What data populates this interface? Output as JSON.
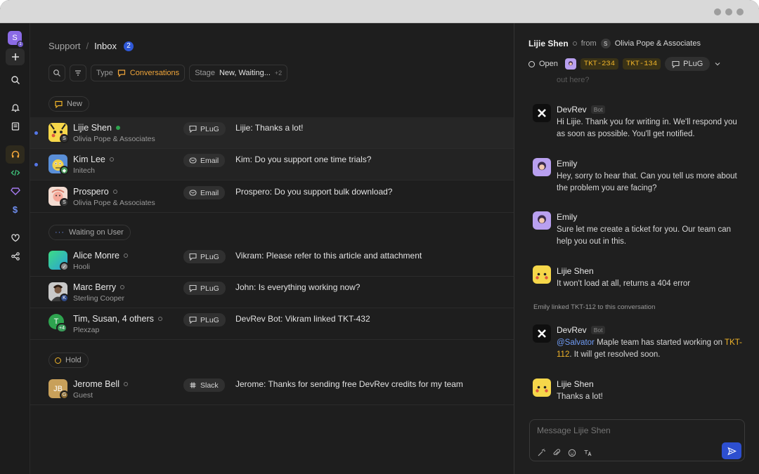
{
  "sidebar": {
    "workspace_initial": "S",
    "workspace_badge": "1",
    "icons": [
      "plus-icon",
      "search-icon",
      "bell-icon",
      "notes-icon",
      "headset-icon",
      "code-icon",
      "diamond-icon",
      "dollar-icon",
      "heart-icon",
      "share-icon"
    ]
  },
  "header": {
    "crumb_root": "Support",
    "crumb_sep": "/",
    "crumb_current": "Inbox",
    "inbox_count": "2"
  },
  "filters": {
    "type_label": "Type",
    "type_value": "Conversations",
    "stage_label": "Stage",
    "stage_value": "New, Waiting...",
    "stage_extra": "+2"
  },
  "groups": {
    "new": "New",
    "waiting": "Waiting on User",
    "hold": "Hold"
  },
  "conversations": [
    {
      "name": "Lijie Shen",
      "org": "Olivia Pope & Associates",
      "channel": "PLuG",
      "message": "Lijie: Thanks a lot!",
      "online": true,
      "unread": true
    },
    {
      "name": "Kim Lee",
      "org": "Initech",
      "channel": "Email",
      "message": "Kim: Do you support one time trials?",
      "online": false,
      "unread": true
    },
    {
      "name": "Prospero",
      "org": "Olivia Pope & Associates",
      "channel": "Email",
      "message": "Prospero: Do you support bulk download?",
      "online": false,
      "unread": false
    },
    {
      "name": "Alice Monre",
      "org": "Hooli",
      "channel": "PLuG",
      "message": "Vikram: Please refer to this article and attachment",
      "online": false,
      "unread": false
    },
    {
      "name": "Marc Berry",
      "org": "Sterling Cooper",
      "channel": "PLuG",
      "message": "John: Is everything working now?",
      "online": false,
      "unread": false
    },
    {
      "name": "Tim, Susan, 4 others",
      "org": "Plexzap",
      "channel": "PLuG",
      "message": "DevRev Bot: Vikram linked TKT-432",
      "online": false,
      "unread": false,
      "avatar_initial": "T",
      "avatar_extra": "+4"
    },
    {
      "name": "Jerome Bell",
      "org": "Guest",
      "channel": "Slack",
      "message": "Jerome: Thanks for sending free DevRev credits for my team",
      "online": false,
      "unread": false,
      "avatar_initial": "JB",
      "badge_initial": "G"
    }
  ],
  "detail": {
    "name": "Lijie Shen",
    "from_label": "from",
    "org": "Olivia Pope & Associates",
    "status": "Open",
    "tickets": [
      "TKT-234",
      "TKT-134"
    ],
    "channel": "PLuG",
    "faded_text": "out here?",
    "messages": [
      {
        "author": "DevRev",
        "tag": "Bot",
        "text": "Hi Lijie. Thank you for writing in. We'll respond you as soon as possible. You'll get notified."
      },
      {
        "author": "Emily",
        "text": "Hey, sorry to hear that. Can you tell us more about the problem you are facing?"
      },
      {
        "author": "Emily",
        "text": "Sure let me create a ticket for you. Our team can help you out in this."
      },
      {
        "author": "Lijie Shen",
        "text": "It won't load at all, returns a 404 error"
      },
      {
        "author": "DevRev",
        "tag": "Bot",
        "mention": "@Salvator",
        "text_a": " Maple team has started working on ",
        "ticket": "TKT-112",
        "text_b": ". It will get resolved soon."
      },
      {
        "author": "Lijie Shen",
        "text": "Thanks a lot!"
      }
    ],
    "system_note": "Emily linked TKT-112 to this conversation",
    "composer_placeholder": "Message Lijie Shen"
  },
  "colors": {
    "accent_blue": "#2d4fd0",
    "ticket_yellow": "#f0b429",
    "type_orange": "#f0a53a",
    "online_green": "#2ea44f"
  }
}
